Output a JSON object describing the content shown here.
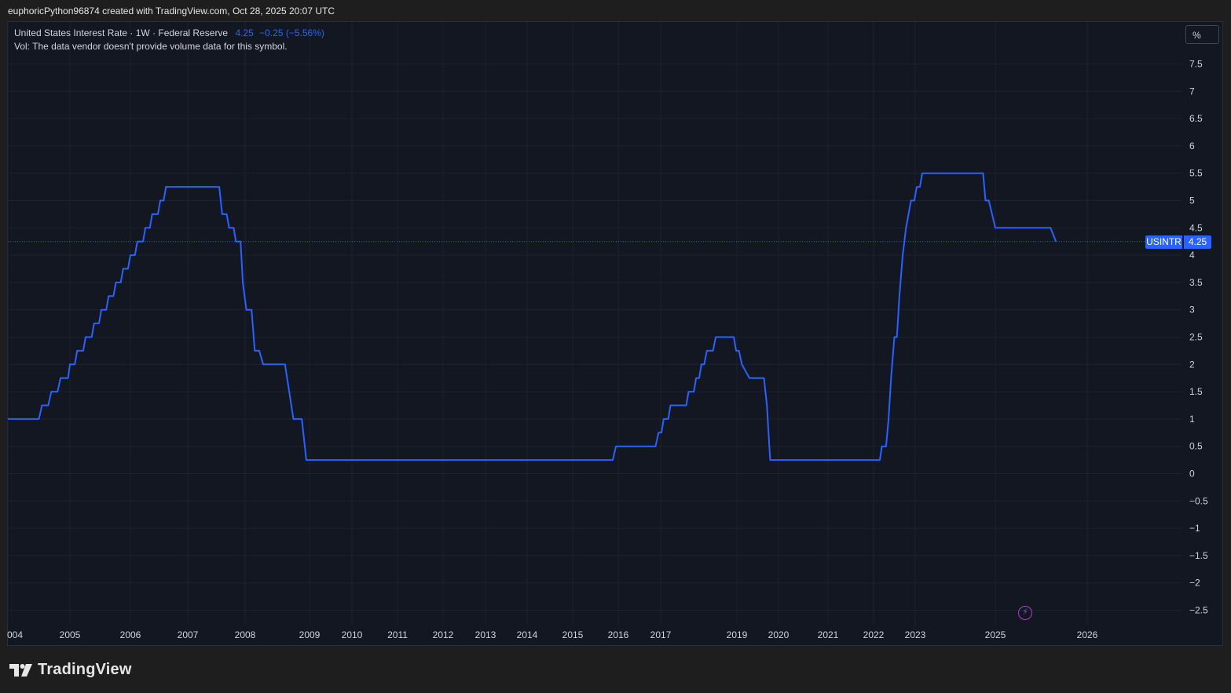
{
  "header": {
    "caption": "euphoricPython96874 created with TradingView.com, Oct 28, 2025 20:07 UTC"
  },
  "legend": {
    "title": "United States Interest Rate · 1W · Federal Reserve",
    "value": "4.25",
    "change": "−0.25 (−5.56%)",
    "vol_note": "Vol: The data vendor doesn't provide volume data for this symbol."
  },
  "unit_button": "%",
  "price_tag": {
    "symbol": "USINTR",
    "value": "4.25"
  },
  "brand": {
    "name": "TradingView"
  },
  "icons": {
    "flash": "flash-icon",
    "logo": "tradingview-logo-icon"
  },
  "colors": {
    "line": "#2962ff",
    "background": "#131722",
    "grid": "#1e222d",
    "text": "#d1d4dc"
  },
  "chart_data": {
    "type": "line",
    "title": "United States Interest Rate · 1W · Federal Reserve",
    "xlabel": "",
    "ylabel": "",
    "ylim": [
      -2.75,
      7.75
    ],
    "grid": true,
    "y_ticks": [
      7.5,
      7,
      6.5,
      6,
      5.5,
      5,
      4.5,
      4,
      3.5,
      3,
      2.5,
      2,
      1.5,
      1,
      0.5,
      0,
      -0.5,
      -1,
      -1.5,
      -2,
      -2.5
    ],
    "y_tick_labels": [
      "7.5",
      "7",
      "6.5",
      "6",
      "5.5",
      "5",
      "4.5",
      "4",
      "3.5",
      "3",
      "2.5",
      "2",
      "1.5",
      "1",
      "0.5",
      "0",
      "−0.5",
      "−1",
      "−1.5",
      "−2",
      "−2.5"
    ],
    "x_ticks": [
      {
        "label": "004",
        "x": 2004.5
      },
      {
        "label": "2005",
        "x": 2005.0
      },
      {
        "label": "2006",
        "x": 2006.0
      },
      {
        "label": "2007",
        "x": 2007.0
      },
      {
        "label": "2008",
        "x": 2008.0
      },
      {
        "label": "2009",
        "x": 2009.0
      },
      {
        "label": "2010",
        "x": 2010.0
      },
      {
        "label": "2011",
        "x": 2011.0
      },
      {
        "label": "2012",
        "x": 2012.0
      },
      {
        "label": "2013",
        "x": 2013.0
      },
      {
        "label": "2014",
        "x": 2014.0
      },
      {
        "label": "2015",
        "x": 2015.0
      },
      {
        "label": "2016",
        "x": 2016.0
      },
      {
        "label": "2017",
        "x": 2017.0
      },
      {
        "label": "2019",
        "x": 2019.0
      },
      {
        "label": "2020",
        "x": 2020.0
      },
      {
        "label": "2021",
        "x": 2021.0
      },
      {
        "label": "2022",
        "x": 2022.0
      },
      {
        "label": "2023",
        "x": 2023.0
      },
      {
        "label": "2025",
        "x": 2025.0
      },
      {
        "label": "2026",
        "x": 2026.0
      }
    ],
    "series": [
      {
        "points": [
          [
            2004.0,
            1.0
          ],
          [
            2004.5,
            1.0
          ],
          [
            2004.55,
            1.25
          ],
          [
            2004.65,
            1.25
          ],
          [
            2004.7,
            1.5
          ],
          [
            2004.8,
            1.5
          ],
          [
            2004.85,
            1.75
          ],
          [
            2004.97,
            1.75
          ],
          [
            2005.0,
            2.0
          ],
          [
            2005.08,
            2.0
          ],
          [
            2005.12,
            2.25
          ],
          [
            2005.22,
            2.25
          ],
          [
            2005.26,
            2.5
          ],
          [
            2005.36,
            2.5
          ],
          [
            2005.4,
            2.75
          ],
          [
            2005.48,
            2.75
          ],
          [
            2005.52,
            3.0
          ],
          [
            2005.6,
            3.0
          ],
          [
            2005.64,
            3.25
          ],
          [
            2005.72,
            3.25
          ],
          [
            2005.76,
            3.5
          ],
          [
            2005.84,
            3.5
          ],
          [
            2005.88,
            3.75
          ],
          [
            2005.96,
            3.75
          ],
          [
            2006.0,
            4.0
          ],
          [
            2006.08,
            4.0
          ],
          [
            2006.12,
            4.25
          ],
          [
            2006.22,
            4.25
          ],
          [
            2006.26,
            4.5
          ],
          [
            2006.34,
            4.5
          ],
          [
            2006.38,
            4.75
          ],
          [
            2006.48,
            4.75
          ],
          [
            2006.52,
            5.0
          ],
          [
            2006.58,
            5.0
          ],
          [
            2006.62,
            5.25
          ],
          [
            2007.55,
            5.25
          ],
          [
            2007.6,
            4.75
          ],
          [
            2007.68,
            4.75
          ],
          [
            2007.72,
            4.5
          ],
          [
            2007.8,
            4.5
          ],
          [
            2007.84,
            4.25
          ],
          [
            2007.92,
            4.25
          ],
          [
            2007.96,
            3.5
          ],
          [
            2008.02,
            3.0
          ],
          [
            2008.1,
            3.0
          ],
          [
            2008.15,
            2.25
          ],
          [
            2008.22,
            2.25
          ],
          [
            2008.28,
            2.0
          ],
          [
            2008.62,
            2.0
          ],
          [
            2008.75,
            1.0
          ],
          [
            2008.88,
            1.0
          ],
          [
            2008.95,
            0.25
          ],
          [
            2015.88,
            0.25
          ],
          [
            2015.95,
            0.5
          ],
          [
            2016.88,
            0.5
          ],
          [
            2016.95,
            0.75
          ],
          [
            2017.02,
            0.75
          ],
          [
            2017.08,
            1.0
          ],
          [
            2017.2,
            1.0
          ],
          [
            2017.26,
            1.25
          ],
          [
            2017.68,
            1.25
          ],
          [
            2017.74,
            1.5
          ],
          [
            2017.88,
            1.5
          ],
          [
            2017.94,
            1.75
          ],
          [
            2018.02,
            1.75
          ],
          [
            2018.08,
            2.0
          ],
          [
            2018.15,
            2.0
          ],
          [
            2018.22,
            2.25
          ],
          [
            2018.38,
            2.25
          ],
          [
            2018.45,
            2.5
          ],
          [
            2018.92,
            2.5
          ],
          [
            2018.98,
            2.25
          ],
          [
            2019.05,
            2.25
          ],
          [
            2019.12,
            2.0
          ],
          [
            2019.3,
            1.75
          ],
          [
            2019.65,
            1.75
          ],
          [
            2019.72,
            1.25
          ],
          [
            2019.8,
            0.25
          ],
          [
            2022.15,
            0.25
          ],
          [
            2022.2,
            0.5
          ],
          [
            2022.3,
            0.5
          ],
          [
            2022.36,
            1.0
          ],
          [
            2022.42,
            1.75
          ],
          [
            2022.5,
            2.5
          ],
          [
            2022.56,
            2.5
          ],
          [
            2022.62,
            3.25
          ],
          [
            2022.7,
            4.0
          ],
          [
            2022.78,
            4.5
          ],
          [
            2022.9,
            5.0
          ],
          [
            2022.98,
            5.0
          ],
          [
            2023.04,
            5.25
          ],
          [
            2023.12,
            5.25
          ],
          [
            2023.18,
            5.5
          ],
          [
            2024.7,
            5.5
          ],
          [
            2024.76,
            5.0
          ],
          [
            2024.84,
            5.0
          ],
          [
            2025.0,
            4.5
          ],
          [
            2025.6,
            4.5
          ],
          [
            2025.66,
            4.25
          ]
        ]
      }
    ],
    "last_value": 4.25
  }
}
